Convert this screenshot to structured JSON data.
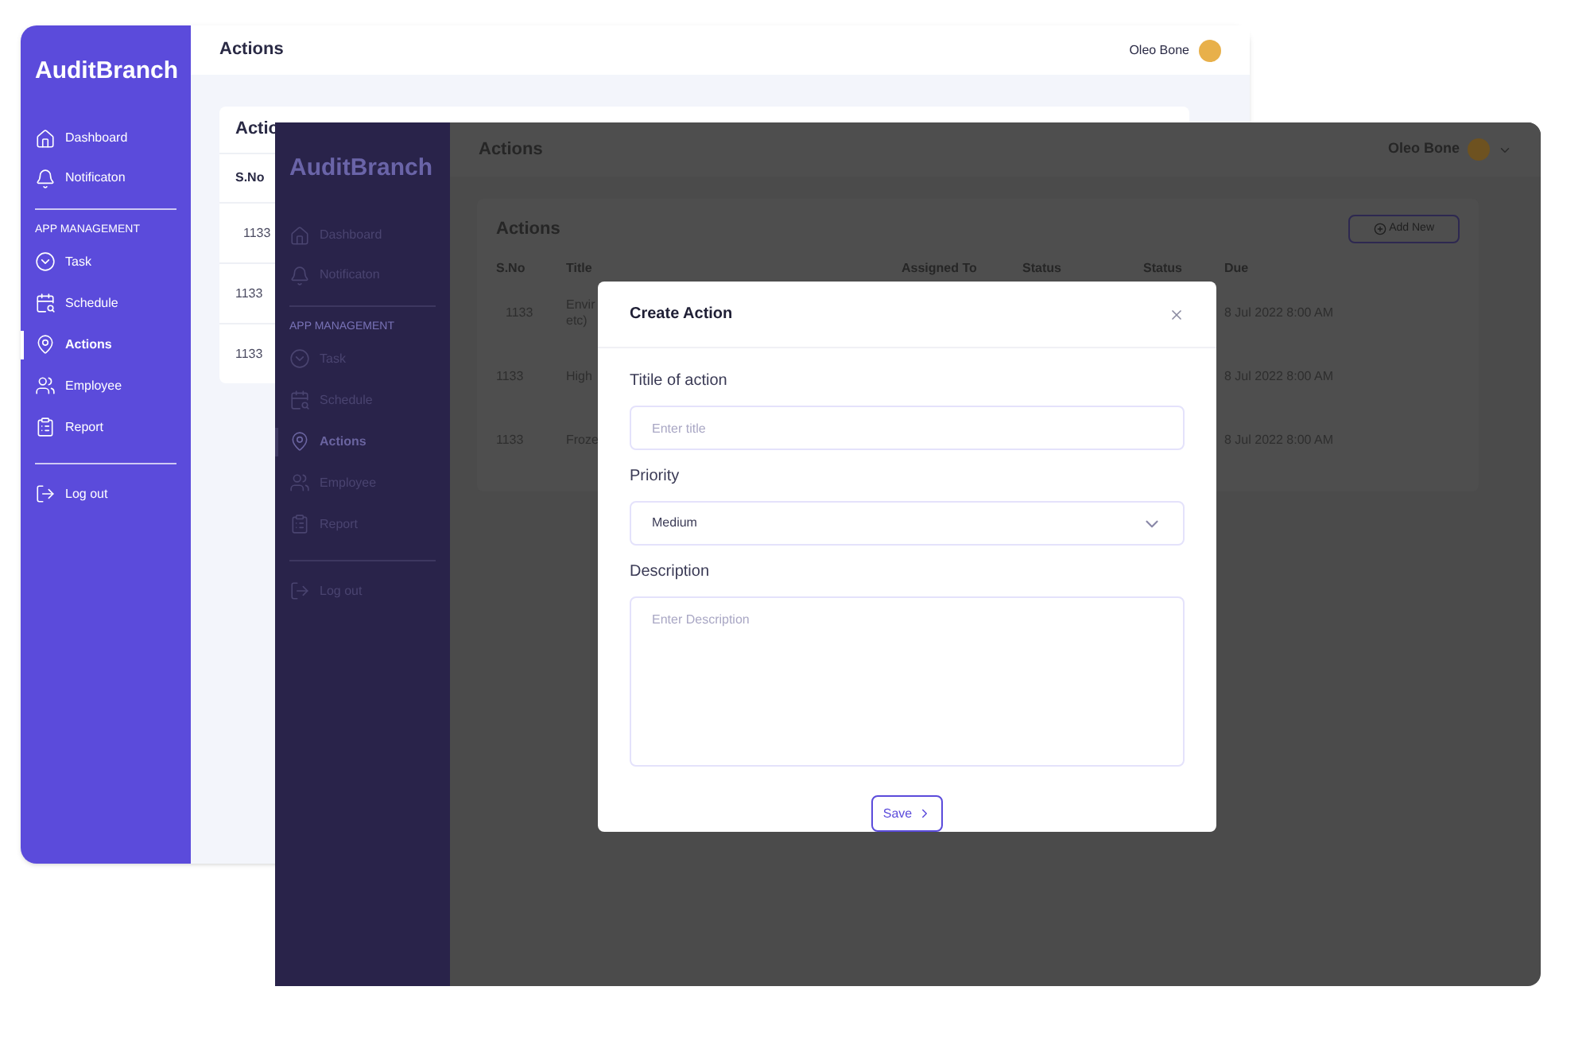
{
  "back_window": {
    "brand": "AuditBranch",
    "nav_top": [
      {
        "label": "Dashboard",
        "kind": "home",
        "selected": false
      },
      {
        "label": "Notificaton",
        "kind": "bell",
        "selected": false
      }
    ],
    "section_label": "APP MANAGEMENT",
    "nav_management": [
      {
        "label": "Task",
        "kind": "task",
        "selected": false
      },
      {
        "label": "Schedule",
        "kind": "calendar",
        "selected": false
      },
      {
        "label": "Actions",
        "kind": "pin",
        "selected": true
      },
      {
        "label": "Employee",
        "kind": "people",
        "selected": false
      },
      {
        "label": "Report",
        "kind": "clipboard",
        "selected": false
      }
    ],
    "logout": "Log out",
    "page_title": "Actions",
    "user": "Oleo Bone",
    "card_title": "Actio",
    "columns": [
      "S.No"
    ],
    "rows": [
      [
        "1133"
      ],
      [
        "1133"
      ],
      [
        "1133"
      ]
    ]
  },
  "front_window": {
    "brand": "AuditBranch",
    "nav_top": [
      {
        "label": "Dashboard",
        "kind": "home",
        "selected": false
      },
      {
        "label": "Notificaton",
        "kind": "bell",
        "selected": false
      }
    ],
    "section_label": "APP MANAGEMENT",
    "nav_management": [
      {
        "label": "Task",
        "kind": "task",
        "selected": false
      },
      {
        "label": "Schedule",
        "kind": "calendar",
        "selected": false
      },
      {
        "label": "Actions",
        "kind": "pin",
        "selected": true
      },
      {
        "label": "Employee",
        "kind": "people",
        "selected": false
      },
      {
        "label": "Report",
        "kind": "clipboard",
        "selected": false
      }
    ],
    "logout": "Log out",
    "page_title": "Actions",
    "user": "Oleo Bone",
    "card_title": "Actions",
    "add_button": "Add New",
    "columns": [
      "S.No",
      "Title",
      "Assigned To",
      "Status",
      "Status",
      "Due"
    ],
    "rows": [
      {
        "sno": "1133",
        "title": [
          "Envir",
          "etc)"
        ],
        "due": "8 Jul 2022 8:00 AM"
      },
      {
        "sno": "1133",
        "title": [
          "High"
        ],
        "due": "8 Jul 2022 8:00 AM"
      },
      {
        "sno": "1133",
        "title": [
          "Froze"
        ],
        "due": "8 Jul 2022 8:00 AM"
      }
    ]
  },
  "modal": {
    "title": "Create Action",
    "fields": [
      {
        "kind": "text",
        "label": "Titile of action",
        "placeholder": "Enter title"
      },
      {
        "kind": "select",
        "label": "Priority",
        "value": "Medium"
      },
      {
        "kind": "textarea",
        "label": "Description",
        "placeholder": "Enter Description"
      }
    ],
    "save_button": "Save"
  }
}
